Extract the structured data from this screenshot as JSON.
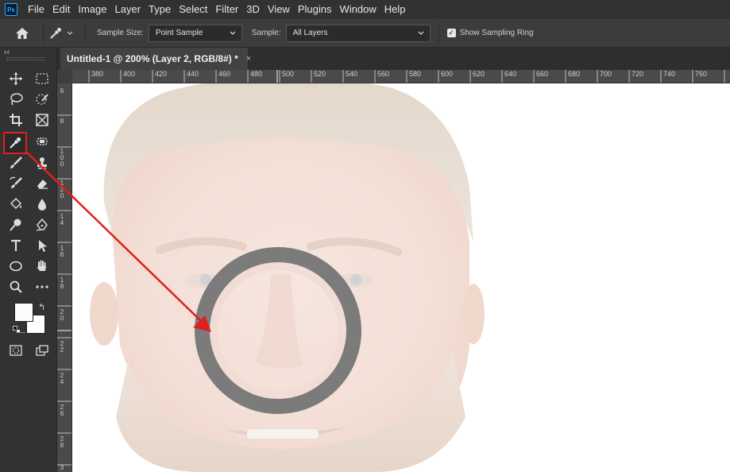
{
  "menu": [
    "File",
    "Edit",
    "Image",
    "Layer",
    "Type",
    "Select",
    "Filter",
    "3D",
    "View",
    "Plugins",
    "Window",
    "Help"
  ],
  "app_logo": "Ps",
  "options": {
    "sample_size_label": "Sample Size:",
    "sample_size_value": "Point Sample",
    "sample_label": "Sample:",
    "sample_value": "All Layers",
    "show_ring_label": "Show Sampling Ring",
    "show_ring_checked": true
  },
  "document_tab": {
    "title": "Untitled-1 @ 200% (Layer 2, RGB/8#) *",
    "close": "×"
  },
  "ruler": {
    "top_labels": [
      "380",
      "400",
      "420",
      "440",
      "460",
      "480",
      "500",
      "520",
      "540",
      "560",
      "580",
      "600",
      "620",
      "640",
      "660",
      "680",
      "700",
      "720",
      "740",
      "760"
    ],
    "left_labels": [
      "6",
      "8",
      "1 0 0",
      "1 2 0",
      "1 4",
      "1 6",
      "1 8",
      "2 0",
      "2 2",
      "2 4",
      "2 6",
      "2 8",
      "3"
    ]
  },
  "toolbar": {
    "collapse": "‹‹",
    "active_tool": "eyedropper"
  },
  "colors": {
    "accent_red": "#e01f1f",
    "ring_gray": "#7b7b7b",
    "skin_sample": "#f1ddd5"
  }
}
